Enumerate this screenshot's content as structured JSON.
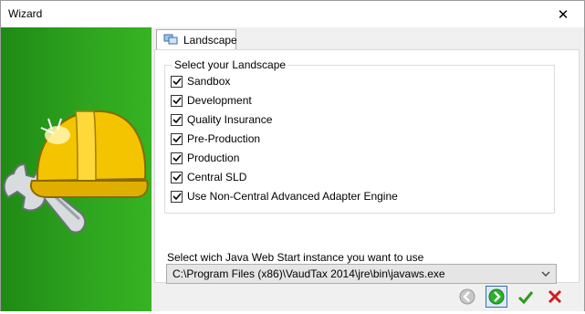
{
  "window": {
    "title": "Wizard",
    "close_symbol": "✕"
  },
  "tab": {
    "label": "Landscape",
    "icon": "landscape-icon"
  },
  "landscape_group": {
    "legend": "Select your Landscape",
    "items": [
      {
        "label": "Sandbox",
        "checked": true
      },
      {
        "label": "Development",
        "checked": true
      },
      {
        "label": "Quality Insurance",
        "checked": true
      },
      {
        "label": "Pre-Production",
        "checked": true
      },
      {
        "label": "Production",
        "checked": true
      },
      {
        "label": "Central SLD",
        "checked": true
      },
      {
        "label": "Use Non-Central Advanced Adapter Engine",
        "checked": true
      }
    ]
  },
  "java": {
    "label": "Select wich Java Web Start instance you want to use",
    "selected": "C:\\Program Files (x86)\\VaudTax 2014\\jre\\bin\\javaws.exe"
  },
  "buttons": {
    "back": "back-icon",
    "next": "next-icon",
    "finish": "check-icon",
    "cancel": "cancel-icon"
  },
  "colors": {
    "panel_green": "#2ea31f",
    "helmet_yellow": "#f4c400",
    "next_blue": "#1e6fd9",
    "finish_green": "#2a9d1a",
    "cancel_red": "#d21d1d"
  }
}
